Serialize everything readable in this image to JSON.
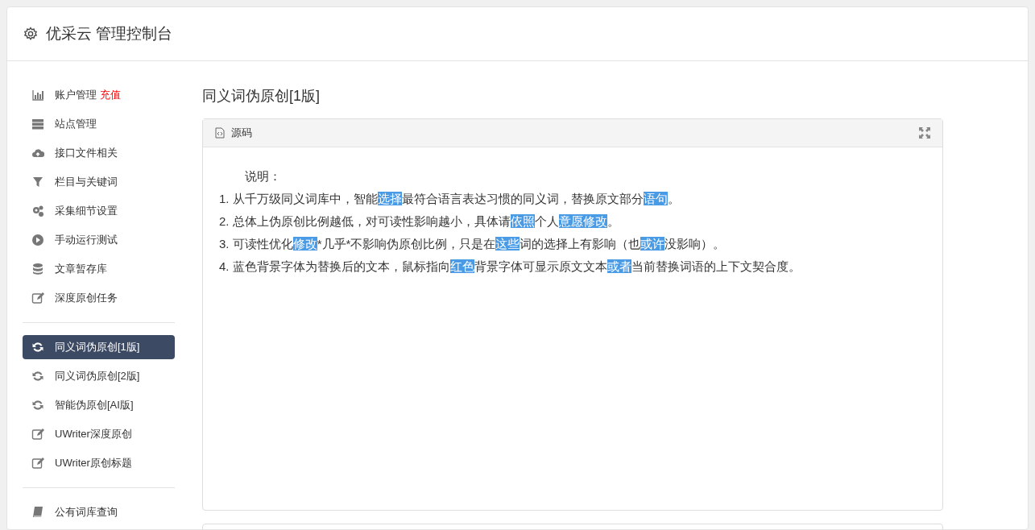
{
  "header": {
    "title": "优采云 管理控制台"
  },
  "sidebar": {
    "groups": [
      {
        "items": [
          {
            "kind": "chart",
            "label": "账户管理",
            "badge": "充值",
            "selected": false
          },
          {
            "kind": "server",
            "label": "站点管理",
            "selected": false
          },
          {
            "kind": "cloud",
            "label": "接口文件相关",
            "selected": false
          },
          {
            "kind": "filter",
            "label": "栏目与关键词",
            "selected": false
          },
          {
            "kind": "gears",
            "label": "采集细节设置",
            "selected": false
          },
          {
            "kind": "play",
            "label": "手动运行测试",
            "selected": false
          },
          {
            "kind": "database",
            "label": "文章暂存库",
            "selected": false
          },
          {
            "kind": "edit",
            "label": "深度原创任务",
            "selected": false
          }
        ]
      },
      {
        "items": [
          {
            "kind": "refresh",
            "label": "同义词伪原创[1版]",
            "selected": true
          },
          {
            "kind": "refresh",
            "label": "同义词伪原创[2版]",
            "selected": false
          },
          {
            "kind": "refresh",
            "label": "智能伪原创[AI版]",
            "selected": false
          },
          {
            "kind": "edit",
            "label": "UWriter深度原创",
            "selected": false
          },
          {
            "kind": "edit",
            "label": "UWriter原创标题",
            "selected": false
          }
        ]
      },
      {
        "items": [
          {
            "kind": "book",
            "label": "公有词库查询",
            "selected": false
          }
        ]
      }
    ]
  },
  "content": {
    "title": "同义词伪原创[1版]",
    "panel": {
      "header": "源码",
      "heading": "说明：",
      "lines": [
        [
          {
            "text": "1. 从千万级同义词库中，智能"
          },
          {
            "text": "选择",
            "highlight": true
          },
          {
            "text": "最符合语言表达习惯的同义词，替换原文部分"
          },
          {
            "text": "语句",
            "highlight": true
          },
          {
            "text": "。"
          }
        ],
        [
          {
            "text": "2. 总体上伪原创比例越低，对可读性影响越小，具体请"
          },
          {
            "text": "依照",
            "highlight": true
          },
          {
            "text": "个人"
          },
          {
            "text": "意愿",
            "highlight": true
          },
          {
            "text": "修改",
            "highlight": true
          },
          {
            "text": "。"
          }
        ],
        [
          {
            "text": "3. 可读性优化"
          },
          {
            "text": "修改",
            "highlight": true
          },
          {
            "text": "*几乎*不影响伪原创比例，只是在"
          },
          {
            "text": "这些",
            "highlight": true
          },
          {
            "text": "词的选择上有影响（也"
          },
          {
            "text": "或许",
            "highlight": true
          },
          {
            "text": "没影响）。"
          }
        ],
        [
          {
            "text": "4. 蓝色背景字体为替换后的文本，鼠标指向"
          },
          {
            "text": "红色",
            "highlight": true
          },
          {
            "text": "背景字体可显示原文文本"
          },
          {
            "text": "或者",
            "highlight": true
          },
          {
            "text": "当前替换词语的上下文契合度。"
          }
        ]
      ]
    }
  }
}
